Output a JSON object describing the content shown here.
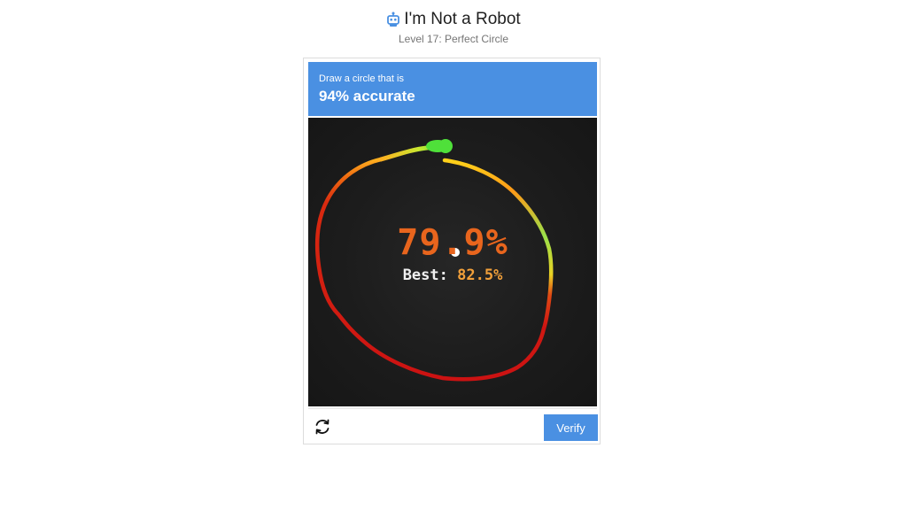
{
  "header": {
    "title": "I'm Not a Robot",
    "subtitle": "Level 17: Perfect Circle",
    "icon": "robot-icon"
  },
  "prompt": {
    "line1": "Draw a circle that is",
    "line2": "94% accurate"
  },
  "result": {
    "score": "79.9%",
    "best_label": "Best:",
    "best_value": "82.5%"
  },
  "footer": {
    "reload_icon": "reload-icon",
    "verify_label": "Verify"
  },
  "colors": {
    "accent": "#4a90e2",
    "score": "#e8651d",
    "best_value": "#f2a03a",
    "canvas": "#1c1c1c"
  }
}
